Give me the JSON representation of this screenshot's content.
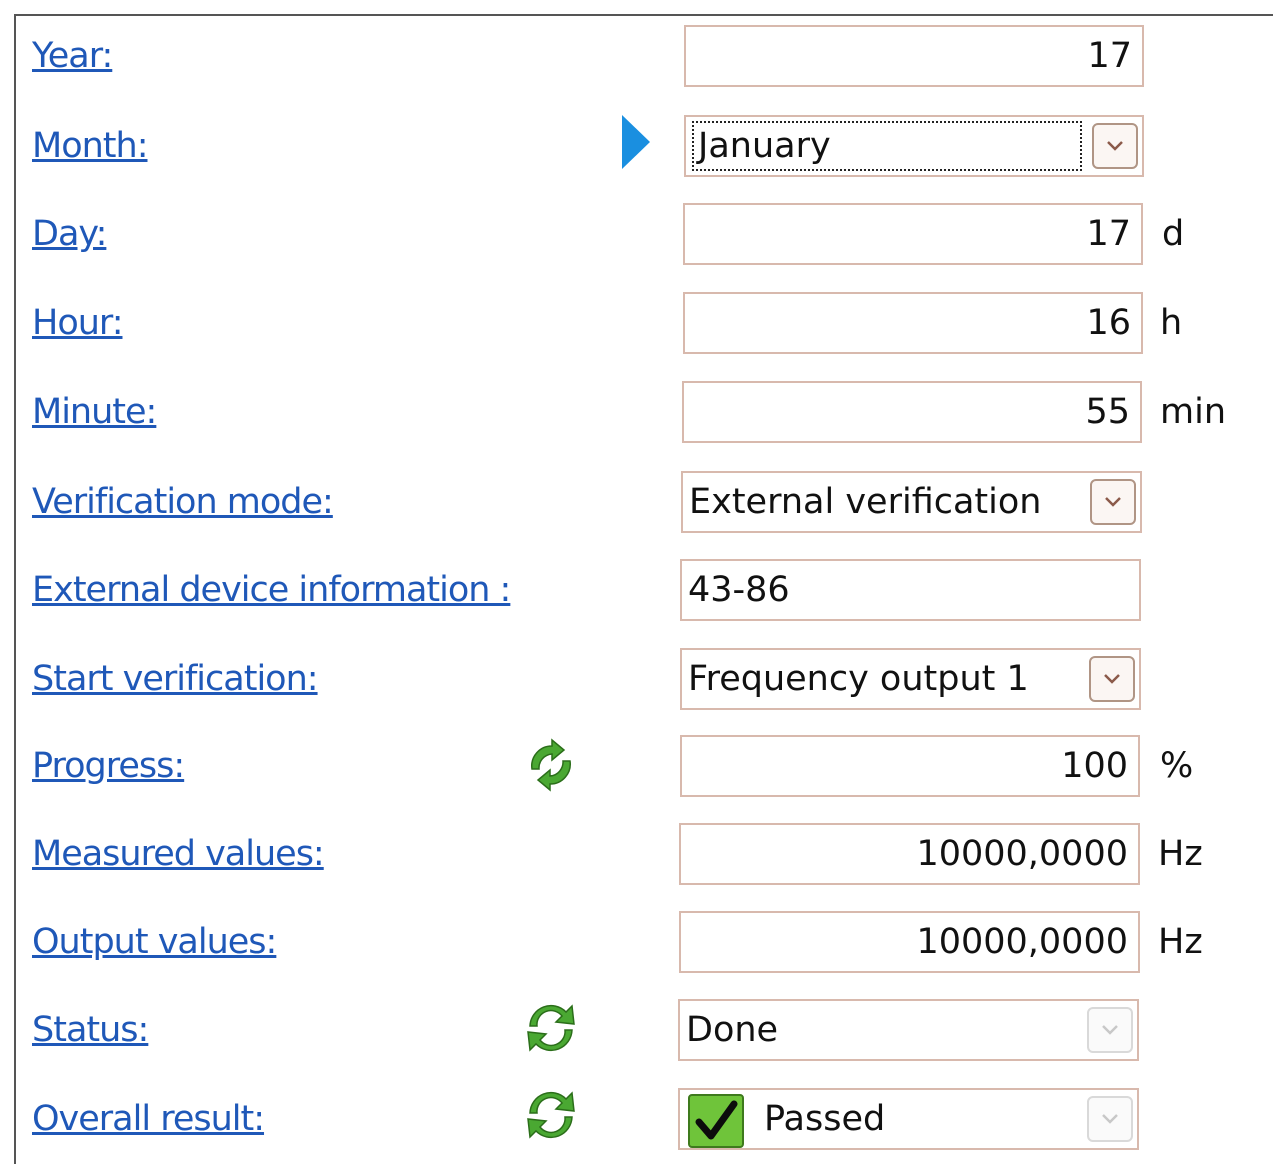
{
  "form": {
    "year": {
      "label": "Year:",
      "value": "17"
    },
    "month": {
      "label": "Month:",
      "value": "January"
    },
    "day": {
      "label": "Day:",
      "value": "17",
      "unit": "d"
    },
    "hour": {
      "label": "Hour:",
      "value": "16",
      "unit": "h"
    },
    "minute": {
      "label": "Minute:",
      "value": "55",
      "unit": "min"
    },
    "verification_mode": {
      "label": "Verification mode:",
      "value": "External verification"
    },
    "external_device": {
      "label": "External device information :",
      "value": "43-86"
    },
    "start_verification": {
      "label": "Start verification:",
      "value": "Frequency output 1"
    },
    "progress": {
      "label": "Progress:",
      "value": "100",
      "unit": "%"
    },
    "measured_values": {
      "label": "Measured values:",
      "value": "10000,0000",
      "unit": "Hz"
    },
    "output_values": {
      "label": "Output values:",
      "value": "10000,0000",
      "unit": "Hz"
    },
    "status": {
      "label": "Status:",
      "value": "Done"
    },
    "overall_result": {
      "label": "Overall result:",
      "value": "Passed"
    }
  },
  "icons": {
    "selection_marker": "play-arrow-icon",
    "dropdown": "chevron-down-icon",
    "refresh": "refresh-icon",
    "passed": "checkmark-icon"
  },
  "colors": {
    "link": "#1f58b8",
    "field_border": "#d8b9ad",
    "marker": "#1a8fe0",
    "refresh_green": "#3f9e2a",
    "passed_green": "#6fc43a"
  }
}
